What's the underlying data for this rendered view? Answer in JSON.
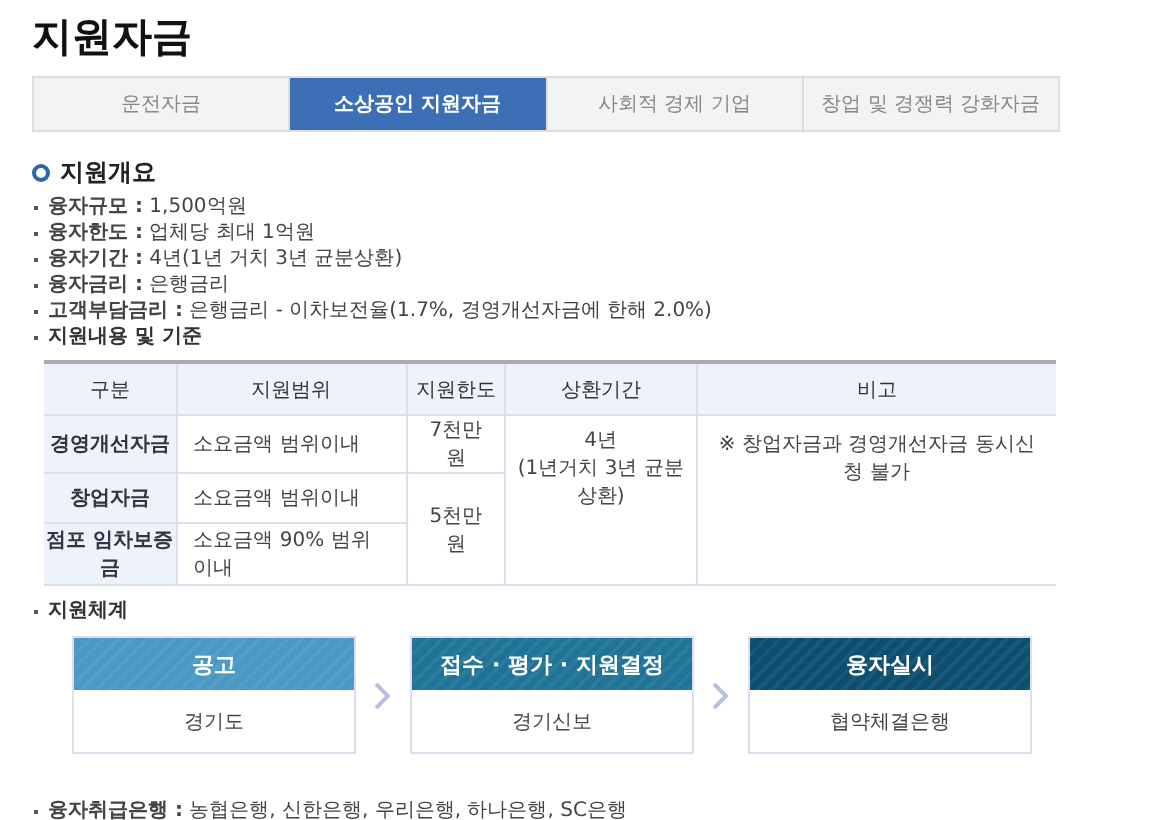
{
  "page_title": "지원자금",
  "tabs": [
    {
      "label": "운전자금",
      "selected": false
    },
    {
      "label": "소상공인 지원자금",
      "selected": true
    },
    {
      "label": "사회적 경제 기업",
      "selected": false
    },
    {
      "label": "창업 및 경쟁력 강화자금",
      "selected": false
    }
  ],
  "section_title": "지원개요",
  "overview": [
    "**융자규모 :** 1,500억원",
    "**융자한도 :** 업체당 최대 1억원",
    "**융자기간 :** 4년(1년 거치 3년 균분상환)",
    "**융자금리 :** 은행금리",
    "**고객부담금리 :** 은행금리 - 이차보전율(1.7%, 경영개선자금에 한해 2.0%)"
  ],
  "table_heading": "지원내용 및 기준",
  "table": {
    "columns": [
      "구분",
      "지원범위",
      "지원한도",
      "상환기간",
      "비고"
    ],
    "groups": [
      {
        "limit": "7천만원",
        "rows": [
          {
            "category": "경영개선자금",
            "scope": "소요금액 범위이내"
          }
        ]
      },
      {
        "limit": "5천만원",
        "rows": [
          {
            "category": "창업자금",
            "scope": "소요금액 범위이내"
          },
          {
            "category": "점포 임차보증금",
            "scope": "소요금액 90% 범위 이내"
          }
        ]
      }
    ],
    "repayment": [
      "4년",
      "(1년거치 3년 균분상환)"
    ],
    "note": "※  창업자금과 경영개선자금 동시신청 불가"
  },
  "flow_heading": "지원체계",
  "flow": [
    {
      "title": "공고",
      "body": "경기도",
      "color": "#4a98c4"
    },
    {
      "title": "접수 · 평가 · 지원결정",
      "body": "경기신보",
      "color": "#1f7397"
    },
    {
      "title": "융자실시",
      "body": "협약체결은행",
      "color": "#0b4e6e"
    }
  ],
  "banks": "**융자취급은행 :** 농협은행, 신한은행, 우리은행, 하나은행, SC은행"
}
